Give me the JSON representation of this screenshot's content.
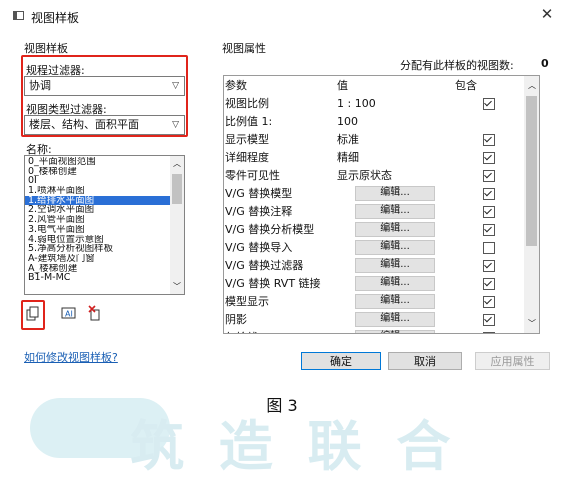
{
  "window": {
    "title": "视图样板",
    "close_glyph": "✕"
  },
  "left": {
    "section_title": "视图样板",
    "discipline_filter": {
      "label": "规程过滤器:",
      "value": "协调"
    },
    "view_type_filter": {
      "label": "视图类型过滤器:",
      "value": "楼层、结构、面积平面"
    },
    "names_label": "名称:",
    "names": [
      "0_平面视图范围",
      "0_楼梯创建",
      "0I",
      "1.喷淋平面图",
      "1.给排水平面图",
      "2.空调水平面图",
      "2.风管平面图",
      "3.电气平面图",
      "4.弱电位置示意图",
      "5.净高分析视图样板",
      "A-建筑墙及门窗",
      "A_楼梯创建",
      "B1-M-MC"
    ],
    "selected_index": 4,
    "help_link": "如何修改视图样板?"
  },
  "right": {
    "section_title": "视图属性",
    "assigned_label": "分配有此样板的视图数:",
    "assigned_count": "0",
    "columns": [
      "参数",
      "值",
      "包含"
    ],
    "rows": [
      {
        "param": "视图比例",
        "value": "1 : 100",
        "kind": "text",
        "include": true,
        "gray": false
      },
      {
        "param": "比例值 1:",
        "value": "100",
        "kind": "text",
        "include": null,
        "gray": true
      },
      {
        "param": "显示模型",
        "value": "标准",
        "kind": "text",
        "include": true,
        "gray": false
      },
      {
        "param": "详细程度",
        "value": "精细",
        "kind": "text",
        "include": true,
        "gray": false
      },
      {
        "param": "零件可见性",
        "value": "显示原状态",
        "kind": "text",
        "include": true,
        "gray": false
      },
      {
        "param": "V/G 替换模型",
        "value": "编辑...",
        "kind": "button",
        "include": true,
        "gray": false
      },
      {
        "param": "V/G 替换注释",
        "value": "编辑...",
        "kind": "button",
        "include": true,
        "gray": false
      },
      {
        "param": "V/G 替换分析模型",
        "value": "编辑...",
        "kind": "button",
        "include": true,
        "gray": false
      },
      {
        "param": "V/G 替换导入",
        "value": "编辑...",
        "kind": "button",
        "include": false,
        "gray": false
      },
      {
        "param": "V/G 替换过滤器",
        "value": "编辑...",
        "kind": "button",
        "include": true,
        "gray": false
      },
      {
        "param": "V/G 替换 RVT 链接",
        "value": "编辑...",
        "kind": "button",
        "include": true,
        "gray": false
      },
      {
        "param": "模型显示",
        "value": "编辑...",
        "kind": "button",
        "include": true,
        "gray": false
      },
      {
        "param": "阴影",
        "value": "编辑...",
        "kind": "button",
        "include": true,
        "gray": false
      },
      {
        "param": "勾绘线",
        "value": "编辑...",
        "kind": "button",
        "include": true,
        "gray": false
      }
    ]
  },
  "buttons": {
    "ok": "确定",
    "cancel": "取消",
    "apply": "应用属性"
  },
  "caption": "图 3",
  "watermark": "筑 造 联 合",
  "colors": {
    "highlight_box": "#e0241b",
    "selection": "#2a6fd6",
    "link": "#1a5fb4"
  }
}
